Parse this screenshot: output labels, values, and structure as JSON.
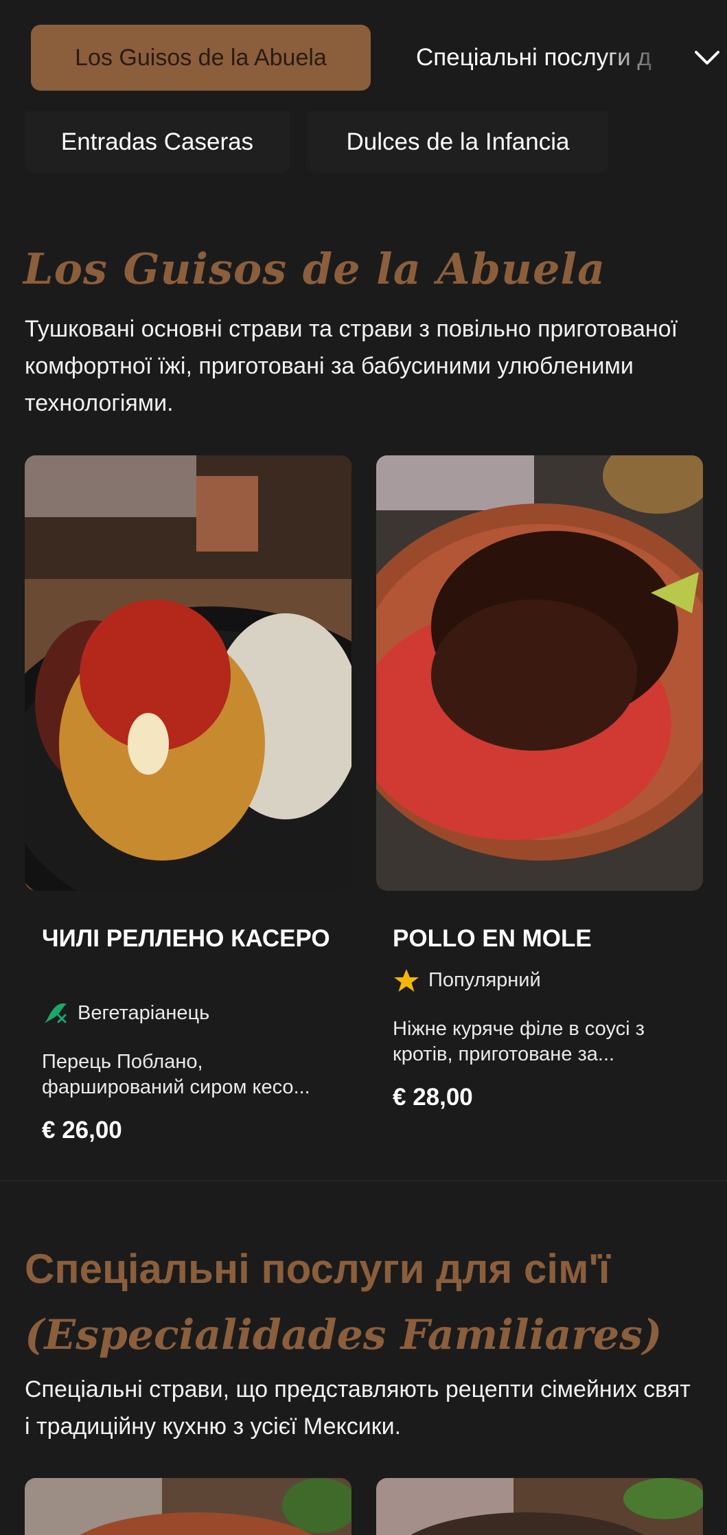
{
  "category_bar": {
    "active": "Los Guisos de la Abuela",
    "next": "Спеціальні послуги д",
    "subtabs": [
      "Entradas Caseras",
      "Dulces de la Infancia"
    ]
  },
  "section1": {
    "title": "Los Guisos de la Abuela",
    "description": "Тушковані основні страви та страви з повільно приготованої комфортної їжі, приготовані за бабусиними улюбленими технологіями.",
    "items": [
      {
        "name": "ЧИЛІ РЕЛЛЕНО КАСЕРО",
        "tag": "Вегетаріанець",
        "tag_icon": "vegetarian-icon",
        "description": "Перець Поблано, фарширований сиром кесо...",
        "price": "€ 26,00"
      },
      {
        "name": "POLLO EN MOLE",
        "tag": "Популярний",
        "tag_icon": "star-icon",
        "description": "Ніжне куряче філе в соусі з кротів, приготоване за...",
        "price": "€ 28,00"
      }
    ]
  },
  "section2": {
    "title_main": "Спеціальні послуги для сім'ї",
    "title_script": "(Especialidades Familiares)",
    "description": "Спеціальні страви, що представляють рецепти сімейних свят і традиційну кухню з усієї Мексики."
  },
  "colors": {
    "background": "#1b1b1b",
    "accent": "#8b5e3c",
    "vegetarian_green": "#1aa86b",
    "star_yellow": "#f5b800"
  }
}
